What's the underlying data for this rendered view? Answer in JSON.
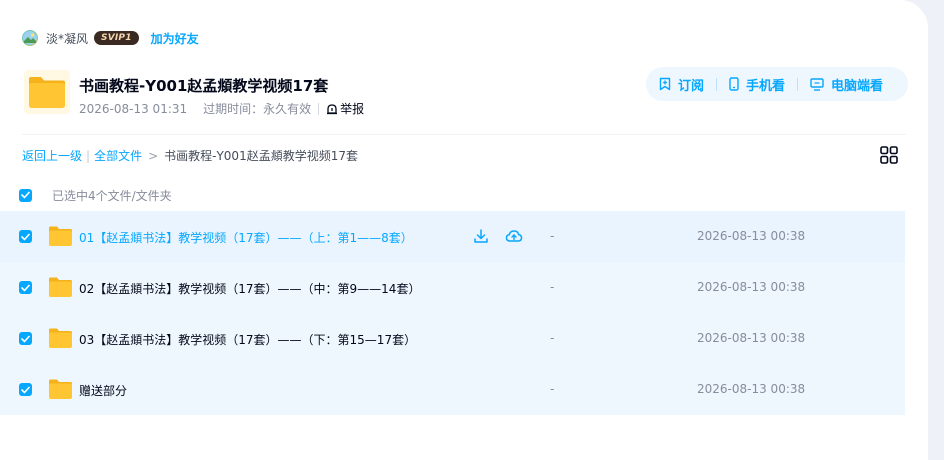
{
  "user": {
    "name": "淡*凝风",
    "badge": "SVIP1",
    "add_friend_label": "加为好友"
  },
  "share": {
    "title": "书画教程-Y001赵孟頫教学视频17套",
    "date": "2026-08-13 01:31",
    "expiry_label": "过期时间：永久有效",
    "report_label": "举报"
  },
  "actions": {
    "subscribe_label": "订阅",
    "mobile_label": "手机看",
    "desktop_label": "电脑端看"
  },
  "breadcrumb": {
    "back_label": "返回上一级",
    "all_files_label": "全部文件",
    "separator": "|",
    "arrow": ">",
    "current": "书画教程-Y001赵孟頫教学视频17套"
  },
  "selection": {
    "summary": "已选中4个文件/文件夹"
  },
  "files": [
    {
      "name": "01【赵孟頫书法】教学视频（17套）——（上：第1——8套）",
      "size": "-",
      "date": "2026-08-13 00:38",
      "checked": true
    },
    {
      "name": "02【赵孟頫书法】教学视频（17套）——（中：第9——14套）",
      "size": "-",
      "date": "2026-08-13 00:38",
      "checked": true
    },
    {
      "name": "03【赵孟頫书法】教学视频（17套）——（下：第15—17套）",
      "size": "-",
      "date": "2026-08-13 00:38",
      "checked": true
    },
    {
      "name": "赠送部分",
      "size": "-",
      "date": "2026-08-13 00:38",
      "checked": true
    }
  ],
  "icons": {
    "avatar": "avatar-image",
    "folder": "folder-icon",
    "report": "report-icon",
    "subscribe": "bookmark-icon",
    "mobile": "phone-icon",
    "desktop": "monitor-icon",
    "grid": "grid-view-icon",
    "download": "download-icon",
    "save_cloud": "cloud-save-icon",
    "check": "checkbox-checked-icon"
  },
  "colors": {
    "accent": "#06a7ff",
    "row_selected": "#eef7fe",
    "folder": "#ffc533",
    "text_primary": "#03081a",
    "text_secondary": "#878c9c"
  }
}
